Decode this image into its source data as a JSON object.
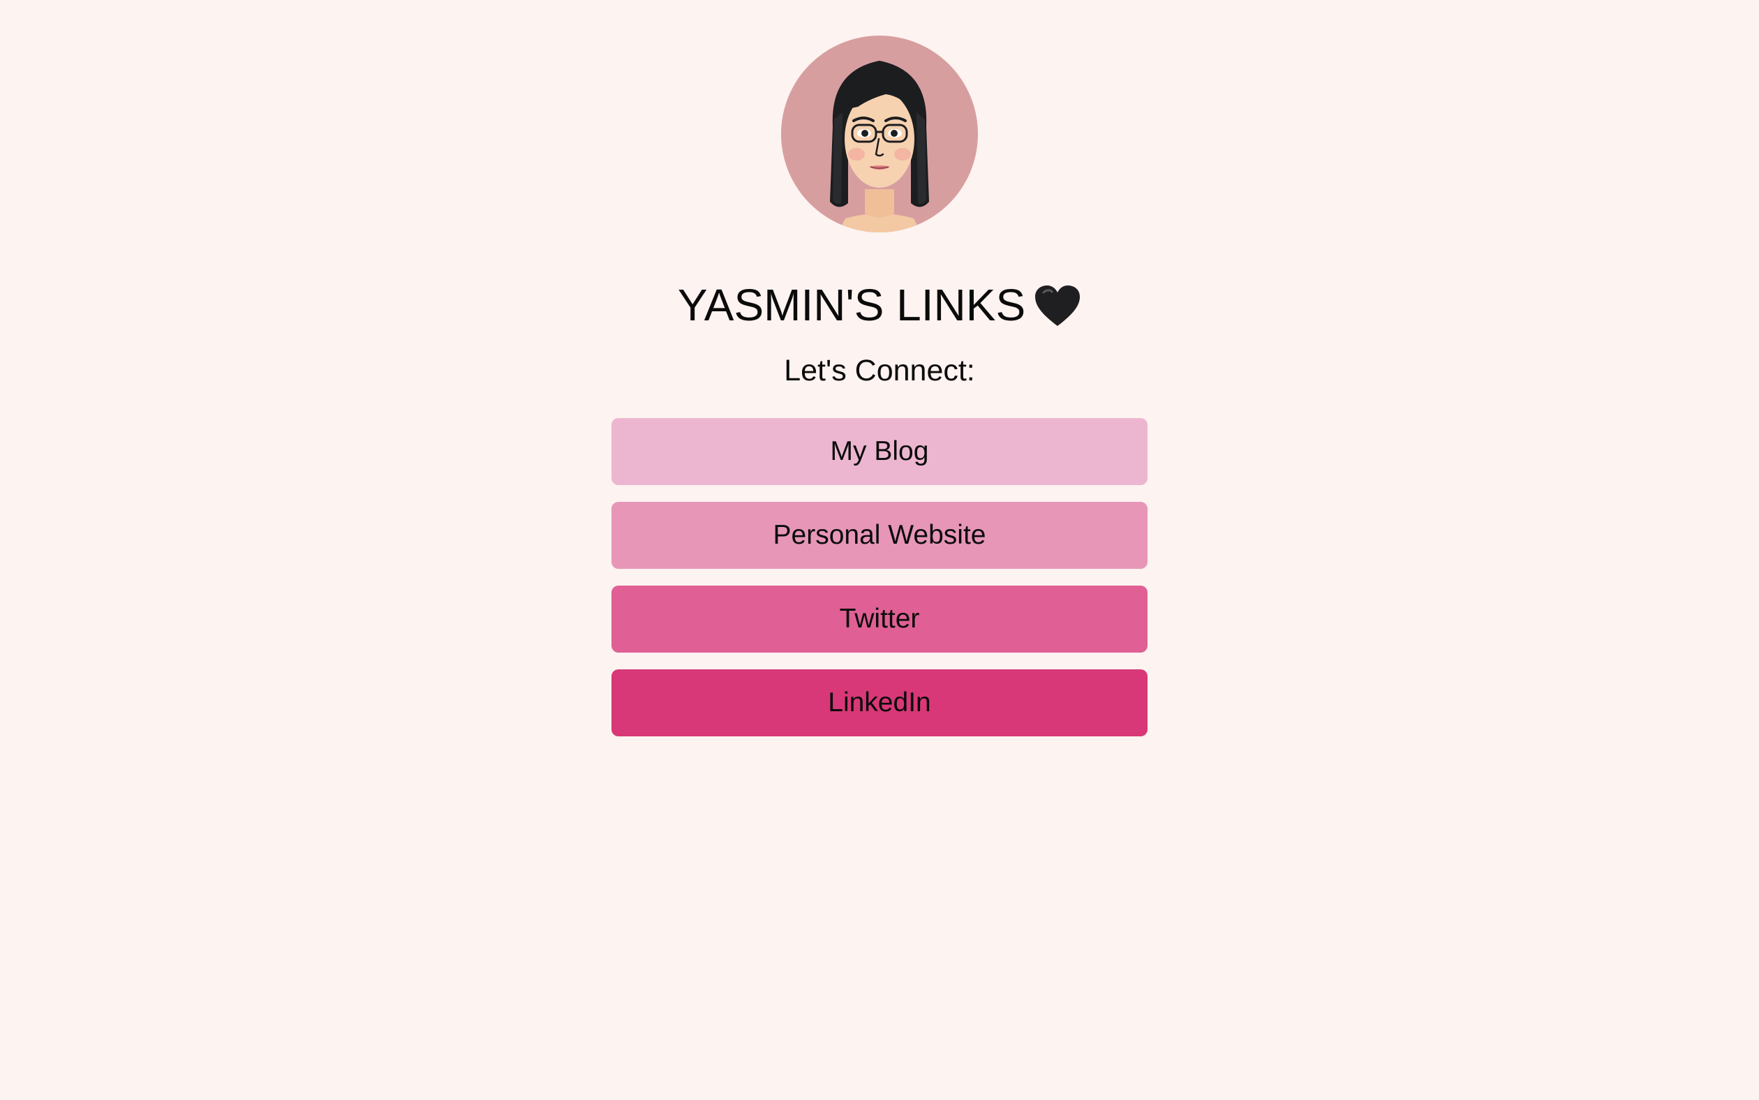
{
  "profile": {
    "avatar_icon": "bitmoji-avatar-icon",
    "title": "YASMIN'S LINKS",
    "title_emoji": "black-heart-icon",
    "subtitle": "Let's Connect:"
  },
  "links": [
    {
      "label": "My Blog",
      "color": "#ecb6d0"
    },
    {
      "label": "Personal Website",
      "color": "#e796b8"
    },
    {
      "label": "Twitter",
      "color": "#e06095"
    },
    {
      "label": "LinkedIn",
      "color": "#d83877"
    }
  ],
  "colors": {
    "background": "#fdf3f1",
    "avatar_background": "#d79ea0"
  }
}
